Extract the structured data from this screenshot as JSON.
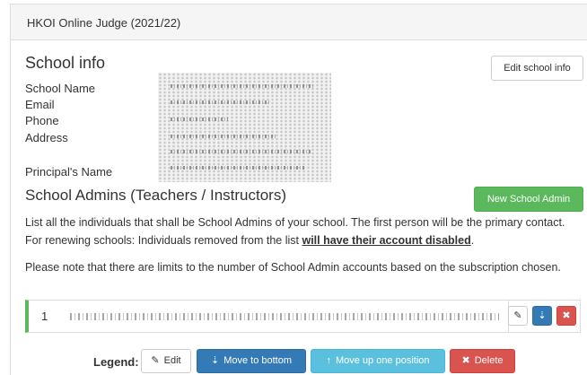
{
  "panel": {
    "title": "HKOI Online Judge (2021/22)"
  },
  "school_info": {
    "heading": "School info",
    "edit_button": "Edit school info",
    "fields": [
      {
        "label": "School Name"
      },
      {
        "label": "Email"
      },
      {
        "label": "Phone"
      },
      {
        "label": "Address"
      },
      {
        "label": "Principal's Name"
      }
    ]
  },
  "admins": {
    "heading": "School Admins (Teachers / Instructors)",
    "new_button": "New School Admin",
    "para1_text": "List all the individuals that shall be School Admins of your school. The first person will be the primary contact. For renewing schools: Individuals removed from the list ",
    "para1_strong": "will have their account disabled",
    "para1_end": ".",
    "para2": "Please note that there are limits to the number of School Admin accounts based on the subscription chosen.",
    "rows": [
      {
        "num": "1"
      }
    ]
  },
  "legend": {
    "label": "Legend:",
    "edit": "Edit",
    "move_bottom": "Move to bottom",
    "move_up": "Move up one position",
    "delete": "Delete"
  },
  "icons": {
    "edit": "edit-icon",
    "sort": "sort-icon",
    "up": "arrow-up-icon",
    "delete": "close-icon"
  },
  "colors": {
    "success": "#5cb85c",
    "primary": "#337ab7",
    "info": "#5bc0de",
    "danger": "#d9534f"
  }
}
